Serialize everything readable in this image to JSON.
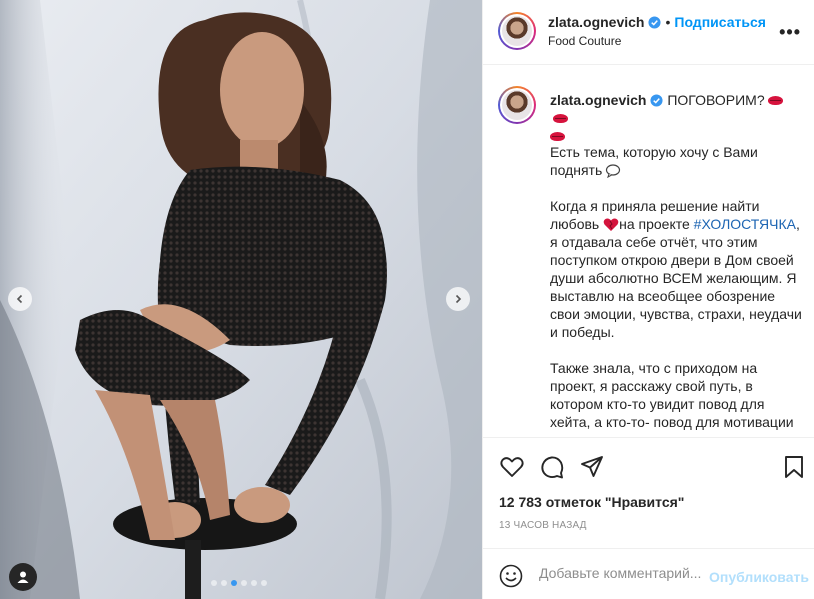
{
  "media": {
    "carousel_count": 6,
    "carousel_active_index": 2,
    "accent_color": "#3897f0"
  },
  "header": {
    "username": "zlata.ognevich",
    "separator": "•",
    "follow_label": "Подписаться",
    "location": "Food Couture",
    "more_label": "•••"
  },
  "caption": {
    "username": "zlata.ognevich",
    "first_line": "ПОГОВОРИМ?",
    "p1": "Есть тема, которую хочу с Вами поднять",
    "p2_before": "Когда я приняла решение найти любовь",
    "p2_mid": "на проекте ",
    "p2_hashtag": "#ХОЛОСТЯЧКА",
    "p2_after": ", я отдавала себе отчёт, что этим поступком открою двери в Дом своей души абсолютно ВСЕМ желающим. Я выставлю на всеобщее обозрение свои эмоции, чувства, страхи, неудачи и победы.",
    "p3": "Также знала, что с приходом на проект, я расскажу свой путь, в котором кто-то увидит повод для хейта, а кто-то- повод для мотивации"
  },
  "footer": {
    "likes": "12 783 отметок \"Нравится\"",
    "time": "13 ЧАСОВ НАЗАД",
    "comment_placeholder": "Добавьте комментарий...",
    "publish_label": "Опубликовать"
  },
  "icons": {
    "like": "heart-icon",
    "comment": "comment-icon",
    "share": "share-icon",
    "save": "bookmark-icon",
    "emoji": "smiley-icon"
  },
  "colors": {
    "link_blue": "#0095f6",
    "hashtag": "#1d65b3",
    "muted": "#8e8e8e",
    "publish_disabled": "#b2dffc"
  }
}
